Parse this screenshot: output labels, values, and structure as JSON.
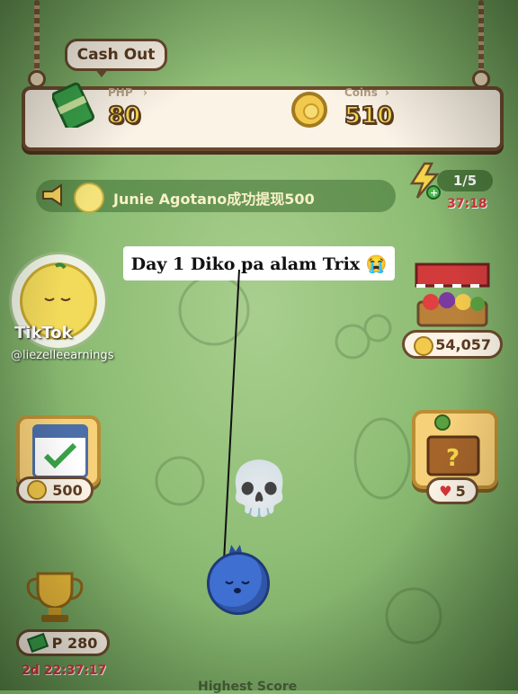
{
  "header": {
    "cash_out_label": "Cash Out",
    "php_label": "PHP",
    "php_value": "80",
    "coins_label": "Coins",
    "coins_value": "510"
  },
  "notice": {
    "user": "Junie Agotano",
    "message": "成功提现500"
  },
  "energy": {
    "count": "1/5",
    "timer": "37:18"
  },
  "caption": {
    "text": "Day 1 Diko pa alam Trix 😭"
  },
  "watermark": {
    "brand": "TikTok",
    "handle": "@liezelleearnings"
  },
  "left_panel": {
    "checkin_value": "500",
    "trophy_value": "P 280",
    "trophy_timer": "2d 22:37:17"
  },
  "right_panel": {
    "shop_value": "54,057",
    "chest_hearts": "5"
  },
  "bottom": {
    "label": "Highest Score"
  },
  "colors": {
    "accent_yellow": "#f5d64a",
    "border_brown": "#6b4a2d",
    "timer_red": "#d7343a",
    "bg_green": "#8fbe76"
  }
}
